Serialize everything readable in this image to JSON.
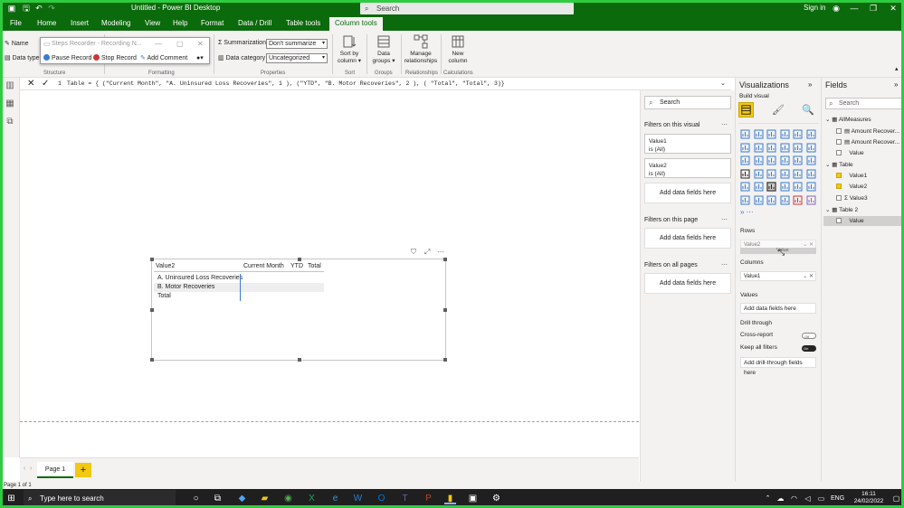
{
  "titlebar": {
    "title": "Untitled - Power BI Desktop",
    "search_placeholder": "Search",
    "signin": "Sign in"
  },
  "menu": {
    "tabs": [
      "File",
      "Home",
      "Insert",
      "Modeling",
      "View",
      "Help",
      "Format",
      "Data / Drill",
      "Table tools",
      "Column tools"
    ],
    "active_tab": "Column tools"
  },
  "ribbon": {
    "name_label": "Name",
    "data_type_label": "Data type",
    "summarization_label": "Summarization",
    "summarization_value": "Don't summarize",
    "data_category_label": "Data category",
    "data_category_value": "Uncategorized",
    "sort_by_column": "Sort by column",
    "data_groups": "Data groups",
    "manage_relationships": "Manage relationships",
    "new_column": "New column",
    "groups": {
      "structure": "Structure",
      "formatting": "Formatting",
      "properties": "Properties",
      "sort": "Sort",
      "groups": "Groups",
      "relationships": "Relationships",
      "calculations": "Calculations"
    }
  },
  "steps_recorder": {
    "title": "Steps Recorder - Recording N...",
    "pause": "Pause Record",
    "stop": "Stop Record",
    "comment": "Add Comment"
  },
  "formula": {
    "line_no": "1",
    "text": "Table = { (\"Current Month\", \"A. Uninsured Loss Recoveries\", 1 ), (\"YTD\", \"B. Motor Recoveries\", 2 ), ( \"Total\", \"Total\", 3)}"
  },
  "matrix": {
    "row_header": "Value2",
    "columns": [
      "Current Month",
      "YTD",
      "Total"
    ],
    "rows": [
      "A. Uninsured Loss Recoveries",
      "B. Motor Recoveries",
      "Total"
    ]
  },
  "filters": {
    "search": "Search",
    "on_this_visual": "Filters on this visual",
    "cards": [
      {
        "name": "Value1",
        "state": "is (All)"
      },
      {
        "name": "Value2",
        "state": "is (All)"
      }
    ],
    "add_fields": "Add data fields here",
    "on_this_page": "Filters on this page",
    "on_all_pages": "Filters on all pages"
  },
  "visualizations": {
    "title": "Visualizations",
    "build_visual": "Build visual",
    "rows_label": "Rows",
    "rows_field": "Value2",
    "drag_ghost": "Value",
    "columns_label": "Columns",
    "columns_field": "Value1",
    "values_label": "Values",
    "add_data_fields": "Add data fields here",
    "drill_through": "Drill through",
    "cross_report": "Cross-report",
    "cross_report_state": "Off",
    "keep_all_filters": "Keep all filters",
    "keep_all_filters_state": "On",
    "add_drillthrough": "Add drill-through fields here"
  },
  "fields": {
    "title": "Fields",
    "search": "Search",
    "tables": [
      {
        "name": "AllMeasures",
        "items": [
          {
            "label": "Amount Recover...",
            "checked": false
          },
          {
            "label": "Amount Recover...",
            "checked": false
          },
          {
            "label": "Value",
            "checked": false
          }
        ]
      },
      {
        "name": "Table",
        "items": [
          {
            "label": "Value1",
            "checked": true
          },
          {
            "label": "Value2",
            "checked": true
          },
          {
            "label": "Value3",
            "checked": false
          }
        ]
      },
      {
        "name": "Table 2",
        "items": [
          {
            "label": "Value",
            "checked": false
          }
        ]
      }
    ]
  },
  "pages": {
    "tab": "Page 1",
    "add": "+"
  },
  "status": {
    "text": "Page 1 of 1"
  },
  "taskbar": {
    "search": "Type here to search",
    "lang": "ENG",
    "time": "16:11",
    "date": "24/02/2022"
  },
  "colors": {
    "brand_green": "#0b6a0b",
    "accent_yellow": "#f2c811",
    "frame_green": "#2ecc40"
  }
}
